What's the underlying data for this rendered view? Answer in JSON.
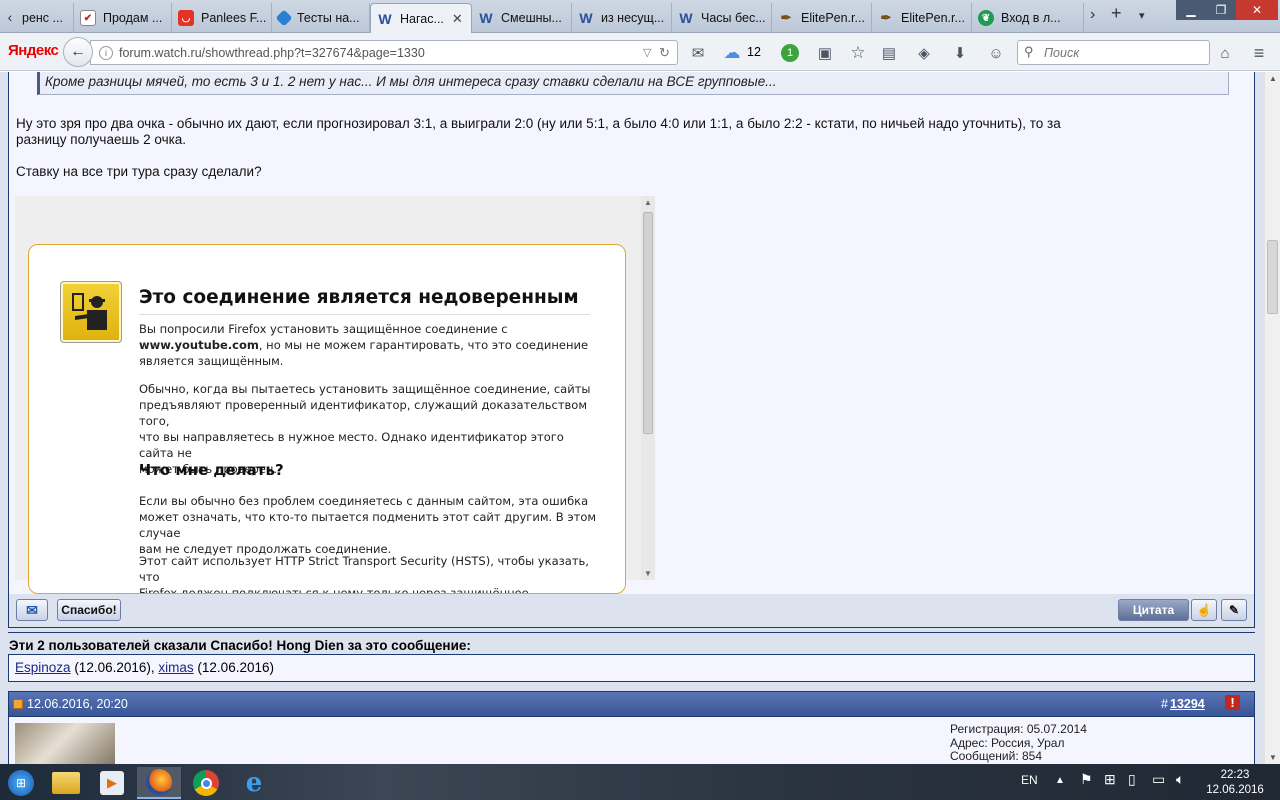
{
  "tabs": [
    {
      "label": "ренс ...",
      "icon": "document-icon"
    },
    {
      "label": "Продам ...",
      "icon": "checkbox-icon"
    },
    {
      "label": "Panlees F...",
      "icon": "aliexpress-icon"
    },
    {
      "label": "Тесты на...",
      "icon": "diamond-icon"
    },
    {
      "label": "Нагас...",
      "icon": "watch-ru-icon",
      "active": true
    },
    {
      "label": "Смешны...",
      "icon": "watch-ru-icon"
    },
    {
      "label": "из несущ...",
      "icon": "watch-ru-icon"
    },
    {
      "label": "Часы бес...",
      "icon": "watch-ru-icon"
    },
    {
      "label": "ElitePen.r...",
      "icon": "pen-icon"
    },
    {
      "label": "ElitePen.r...",
      "icon": "pen-icon"
    },
    {
      "label": "Вход в л...",
      "icon": "leaf-icon"
    }
  ],
  "browser": {
    "logo": "Яндекс",
    "url": "forum.watch.ru/showthread.php?t=327674&page=1330",
    "weather": "12",
    "badge": "1",
    "search_placeholder": "Поиск"
  },
  "post": {
    "quote": "Кроме разницы мячей, то есть 3 и 1. 2 нет у нас... И мы для интереса сразу ставки сделали на ВСЕ групповые...",
    "para1_line1": "Ну это зря про два очка - обычно их дают, если прогнозировал 3:1, а выиграли 2:0 (ну или 5:1, а было 4:0 или 1:1, а было 2:2 - кстати, по ничьей надо уточнить), то за",
    "para1_line2": "разницу получаешь 2 очка.",
    "para2": "Ставку на все три тура сразу сделали?",
    "thanks_button": "Спасибо!",
    "quote_button": "Цитата"
  },
  "embed_error": {
    "title": "Это соединение является недоверенным",
    "p1_a": "Вы попросили Firefox установить защищённое соединение с",
    "p1_host": "www.youtube.com",
    "p1_b": ", но мы не можем гарантировать, что это соединение",
    "p1_c": "является защищённым.",
    "p2_l1": "Обычно, когда вы пытаетесь установить защищённое соединение, сайты",
    "p2_l2": "предъявляют проверенный идентификатор, служащий доказательством того,",
    "p2_l3": "что вы направляетесь в нужное место. Однако идентификатор этого сайта не",
    "p2_l4": "может быть проверен.",
    "h2": "Что мне делать?",
    "p3_l1": "Если вы обычно без проблем соединяетесь с данным сайтом, эта ошибка",
    "p3_l2": "может означать, что кто-то пытается подменить этот сайт другим. В этом случае",
    "p3_l3": "вам не следует продолжать соединение.",
    "p4_l1": "Этот сайт использует HTTP Strict Transport Security (HSTS), чтобы указать, что",
    "p4_l2": "Firefox должен подключаться к нему только через защищённое соединение. В"
  },
  "thanks": {
    "header": "Эти 2 пользователей сказали Спасибо! Hong Dien за это сообщение:",
    "users": [
      {
        "name": "Espinoza",
        "date": "(12.06.2016)"
      },
      {
        "name": "ximas",
        "date": "(12.06.2016)"
      }
    ]
  },
  "next_post": {
    "date": "12.06.2016, 20:20",
    "number_prefix": "#",
    "number": "13294",
    "reg": "Регистрация: 05.07.2014",
    "address": "Адрес: Россия, Урал",
    "messages": "Сообщений: 854"
  },
  "taskbar": {
    "lang": "EN",
    "time": "22:23",
    "date": "12.06.2016"
  }
}
